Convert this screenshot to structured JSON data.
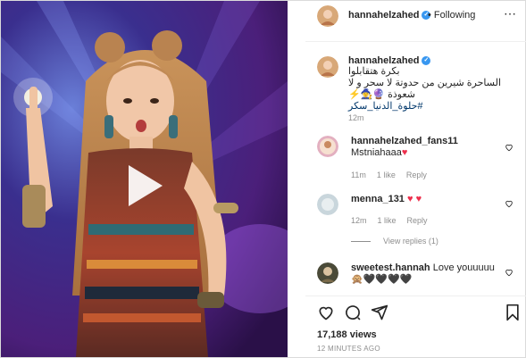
{
  "header": {
    "username": "hannahelzahed",
    "verified_icon": "verified-badge-icon",
    "separator": "•",
    "follow_label": "Following",
    "more_icon": "more-options-icon"
  },
  "caption": {
    "username": "hannahelzahed",
    "line1": "بكرة هتقابلوا",
    "line2": "الساحرة شيرين من حدوتة لا سحر و لا",
    "line3": "شعوذة 🔮🧙‍♀️⚡",
    "hashtag": "#حلوة_الدنيا_سكر",
    "time": "12m"
  },
  "comments": [
    {
      "username": "hannahelzahed_fans11",
      "text": "Mstniahaaa",
      "emoji": "♥",
      "time": "11m",
      "likes": "1 like",
      "reply": "Reply"
    },
    {
      "username": "menna_131",
      "text": "",
      "emoji": "♥ ♥",
      "time": "12m",
      "likes": "1 like",
      "reply": "Reply"
    },
    {
      "username": "sweetest.hannah",
      "text": "Love youuuuu",
      "emoji": "🙊🖤🖤🖤🖤",
      "time": "",
      "likes": "",
      "reply": ""
    }
  ],
  "view_replies": "View replies (1)",
  "actions": {
    "like_icon": "heart-icon",
    "comment_icon": "comment-icon",
    "share_icon": "share-icon",
    "save_icon": "bookmark-icon"
  },
  "stats": {
    "views": "17,188 views",
    "time_ago": "12 MINUTES AGO"
  },
  "colors": {
    "verified": "#3897f0",
    "heart": "#ed2f4c",
    "link": "#00376b",
    "muted": "#8e8e8e"
  }
}
